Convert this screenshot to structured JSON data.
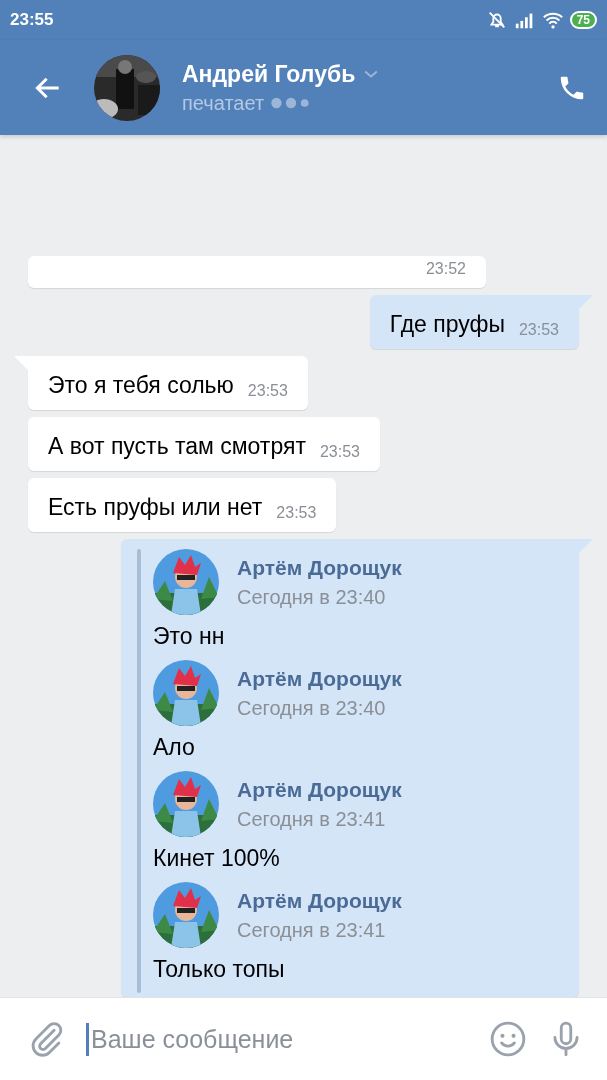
{
  "status_bar": {
    "time": "23:55",
    "battery": "75"
  },
  "header": {
    "name": "Андрей Голубь",
    "status": "печатает"
  },
  "messages": [
    {
      "kind": "in",
      "tail": false,
      "time": "23:52"
    },
    {
      "kind": "out",
      "tail": true,
      "text": "Где пруфы",
      "time": "23:53"
    },
    {
      "kind": "in",
      "tail": true,
      "text": "Это я тебя солью",
      "time": "23:53"
    },
    {
      "kind": "in",
      "tail": false,
      "text": "А вот пусть там смотрят",
      "time": "23:53"
    },
    {
      "kind": "in",
      "tail": false,
      "text": "Есть пруфы или нет",
      "time": "23:53"
    },
    {
      "kind": "forward",
      "tail": true,
      "items": [
        {
          "author": "Артём Дорощук",
          "date": "Сегодня в 23:40",
          "text": "Это нн"
        },
        {
          "author": "Артём Дорощук",
          "date": "Сегодня в 23:40",
          "text": "Ало"
        },
        {
          "author": "Артём Дорощук",
          "date": "Сегодня в 23:41",
          "text": "Кинет 100%"
        },
        {
          "author": "Артём Дорощук",
          "date": "Сегодня в 23:41",
          "text": "Только топы"
        }
      ]
    }
  ],
  "composer": {
    "placeholder": "Ваше сообщение"
  }
}
